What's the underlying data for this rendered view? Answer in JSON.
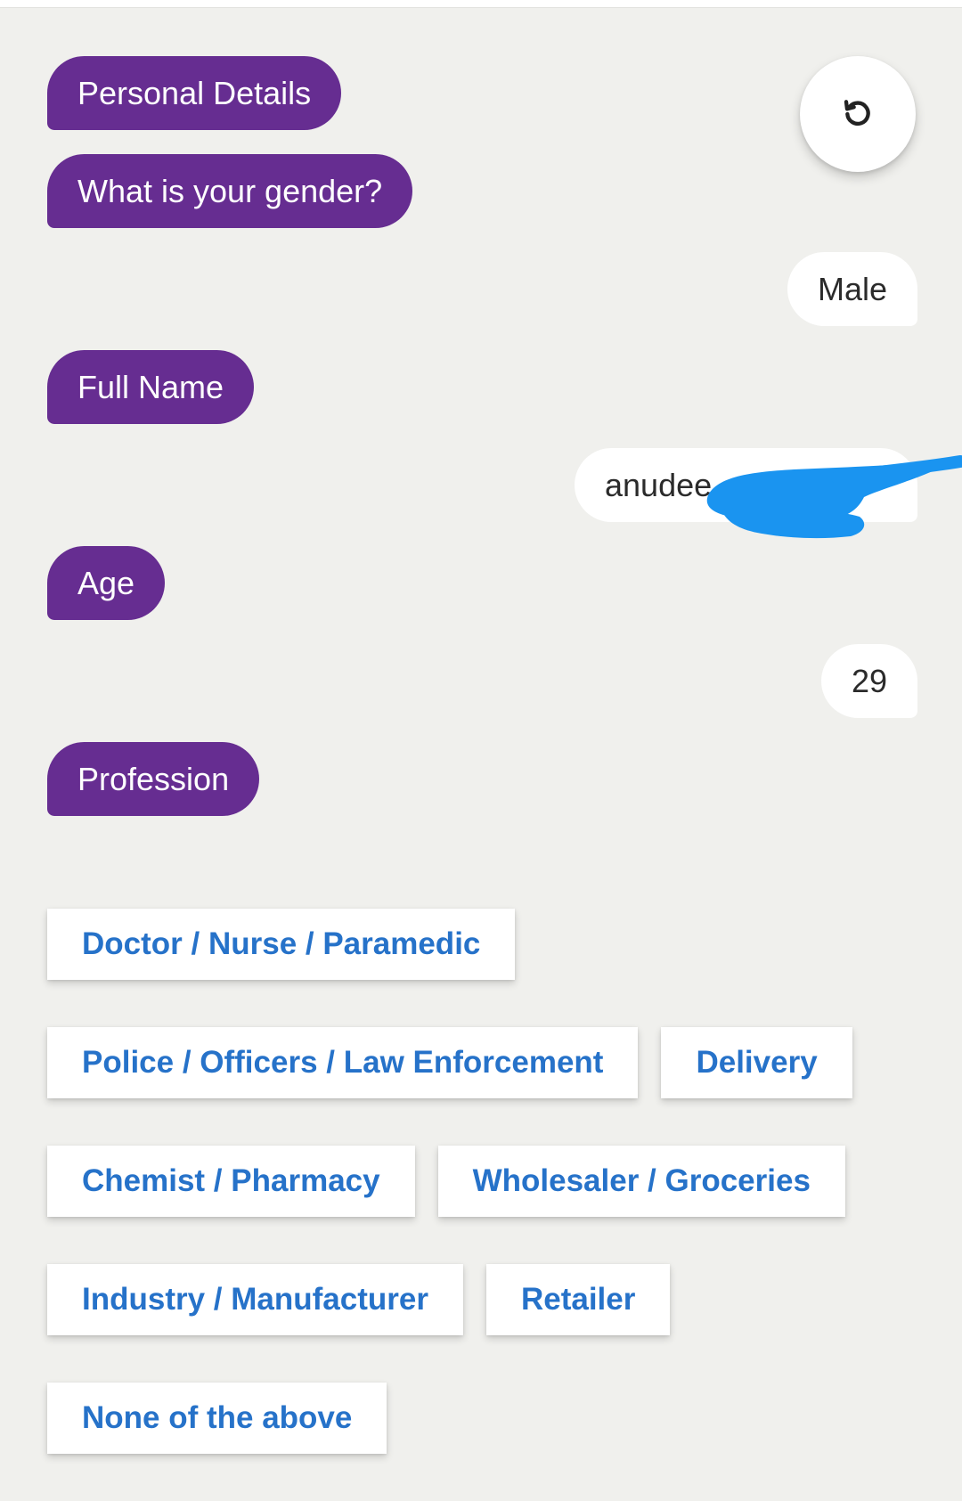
{
  "chat": {
    "bot_messages": [
      "Personal Details",
      "What is your gender?",
      "Full Name",
      "Age",
      "Profession"
    ],
    "user_replies": [
      "Male",
      "anudee",
      "29"
    ]
  },
  "controls": {
    "refresh_icon": "refresh-icon"
  },
  "options": [
    "Doctor / Nurse / Paramedic",
    "Police / Officers / Law Enforcement",
    "Delivery",
    "Chemist / Pharmacy",
    "Wholesaler / Groceries",
    "Industry / Manufacturer",
    "Retailer",
    "None of the above"
  ],
  "colors": {
    "bot_bubble": "#662d91",
    "option_text": "#2672c9",
    "background": "#f0f0ed",
    "redaction": "#1a94f0"
  }
}
